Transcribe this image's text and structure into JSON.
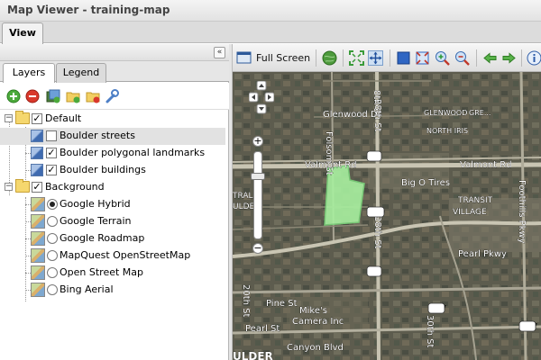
{
  "window": {
    "title": "Map Viewer - training-map"
  },
  "top_tabs": [
    {
      "label": "View"
    }
  ],
  "left_panel": {
    "collapse_glyph": "«",
    "tabs": [
      {
        "label": "Layers",
        "active": true
      },
      {
        "label": "Legend",
        "active": false
      }
    ],
    "toolbar_icons": [
      "add-layer-icon",
      "remove-layer-icon",
      "add-server-icon",
      "add-folder-icon",
      "remove-folder-icon",
      "properties-wrench-icon"
    ],
    "tree": {
      "default_group": {
        "label": "Default",
        "expander": "−",
        "layers": [
          {
            "label": "Boulder streets",
            "checked": false,
            "selected": true
          },
          {
            "label": "Boulder polygonal landmarks",
            "checked": true,
            "selected": false
          },
          {
            "label": "Boulder buildings",
            "checked": true,
            "selected": false
          }
        ]
      },
      "background_group": {
        "label": "Background",
        "expander": "−",
        "layers": [
          {
            "label": "Google Hybrid",
            "active": true
          },
          {
            "label": "Google Terrain",
            "active": false
          },
          {
            "label": "Google Roadmap",
            "active": false
          },
          {
            "label": "MapQuest OpenStreetMap",
            "active": false
          },
          {
            "label": "Open Street Map",
            "active": false
          },
          {
            "label": "Bing Aerial",
            "active": false
          }
        ]
      }
    },
    "check_glyph": "✓"
  },
  "map_toolbar": {
    "full_screen_label": "Full Screen",
    "icons": [
      "full-screen-icon",
      "zoom-to-extent-globe-icon",
      "zoom-to-max-extent-icon",
      "pan-icon",
      "zoom-box-in-icon",
      "zoom-box-out-icon",
      "zoom-in-icon",
      "zoom-out-icon",
      "previous-extent-icon",
      "next-extent-icon",
      "info-icon"
    ]
  },
  "map": {
    "street_labels": [
      "8th St",
      "Glenwood Dr",
      "GLENWOOD",
      "GRE...",
      "NORTH IRIS",
      "Folsom St",
      "Valmont Rd",
      "Valmont Rd",
      "36",
      "119",
      "Big O Tires",
      "TRANSIT",
      "VILLAGE",
      "Foothills Pkwy",
      "TRAL",
      "ULDER",
      "28th St",
      "28th St",
      "36",
      "Pearl Pkwy",
      "Pine St",
      "20th St",
      "Mike's",
      "Camera Inc",
      "Pearl St",
      "157",
      "Canyon Blvd",
      "30th St",
      "157",
      "ULDER"
    ],
    "colors": {
      "landmark_fill": "#a8f0a0",
      "landmark_stroke": "#7ad27a",
      "shield_fill": "#ffffff",
      "road_label": "#ffffff"
    },
    "nav_icons": [
      "pan-up-icon",
      "pan-left-icon",
      "pan-right-icon",
      "pan-down-icon",
      "zoom-in-icon",
      "zoom-out-icon"
    ],
    "zoom_plus": "+",
    "zoom_minus": "−"
  }
}
